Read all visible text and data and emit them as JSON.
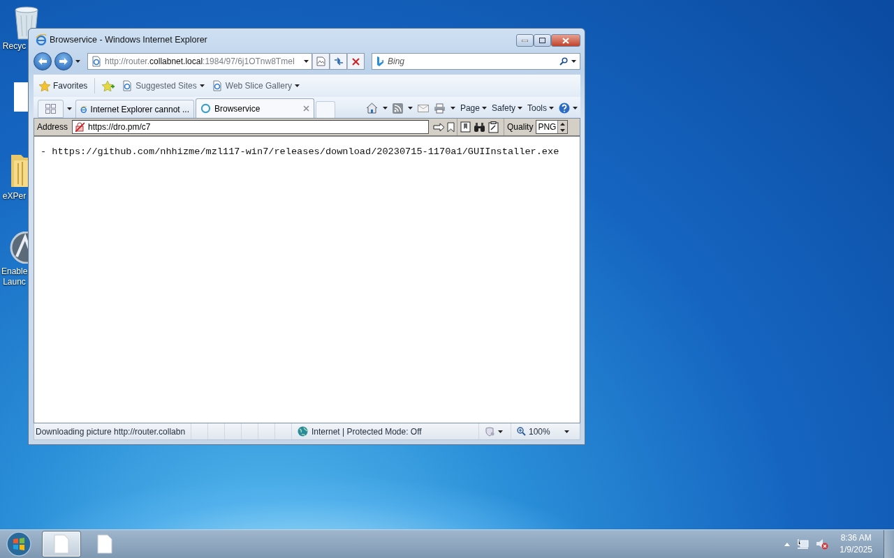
{
  "desktop": {
    "icons": [
      {
        "kind": "recycle-bin",
        "lines": [
          "Recyc"
        ]
      },
      {
        "kind": "blank"
      },
      {
        "kind": "folder",
        "lines": [
          "eXPer"
        ]
      },
      {
        "kind": "launcher",
        "lines": [
          "Enable",
          "Launc"
        ]
      }
    ]
  },
  "window": {
    "title": "Browservice - Windows Internet Explorer",
    "url_parts": [
      "http://router.",
      "collabnet.local",
      ":1984/97/6j1OTnw8TmeI"
    ],
    "search": {
      "placeholder": "Bing"
    },
    "favorites_bar": {
      "favorites": "Favorites",
      "links": [
        "Suggested Sites",
        "Web Slice Gallery"
      ]
    },
    "tabs": [
      {
        "label": "Internet Explorer cannot ...",
        "selected": false
      },
      {
        "label": "Browservice",
        "selected": true
      }
    ],
    "command_menus": [
      "Page",
      "Safety",
      "Tools"
    ],
    "browservice_bar": {
      "address_label": "Address",
      "address": "https://dro.pm/c7",
      "quality_label": "Quality",
      "quality": "PNG"
    },
    "page_text": "- https://github.com/nhhizme/mzl117-win7/releases/download/20230715-1170a1/GUIInstaller.exe",
    "status_bar": {
      "message": "Downloading picture http://router.collabn",
      "zone": "Internet | Protected Mode: Off",
      "zoom": "100%"
    }
  },
  "taskbar": {
    "buttons": [
      {
        "selected": true
      },
      {
        "selected": false
      }
    ],
    "clock": {
      "time": "8:36 AM",
      "date": "1/9/2025"
    }
  }
}
